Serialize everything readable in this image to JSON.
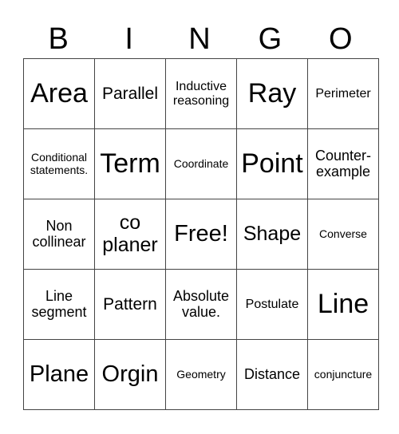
{
  "header": [
    "B",
    "I",
    "N",
    "G",
    "O"
  ],
  "rows": [
    [
      "Area",
      "Parallel",
      "Inductive reasoning",
      "Ray",
      "Perimeter"
    ],
    [
      "Conditional statements.",
      "Term",
      "Coordinate",
      "Point",
      "Counter-example"
    ],
    [
      "Non collinear",
      "co planer",
      "Free!",
      "Shape",
      "Converse"
    ],
    [
      "Line segment",
      "Pattern",
      "Absolute value.",
      "Postulate",
      "Line"
    ],
    [
      "Plane",
      "Orgin",
      "Geometry",
      "Distance",
      "conjuncture"
    ]
  ]
}
